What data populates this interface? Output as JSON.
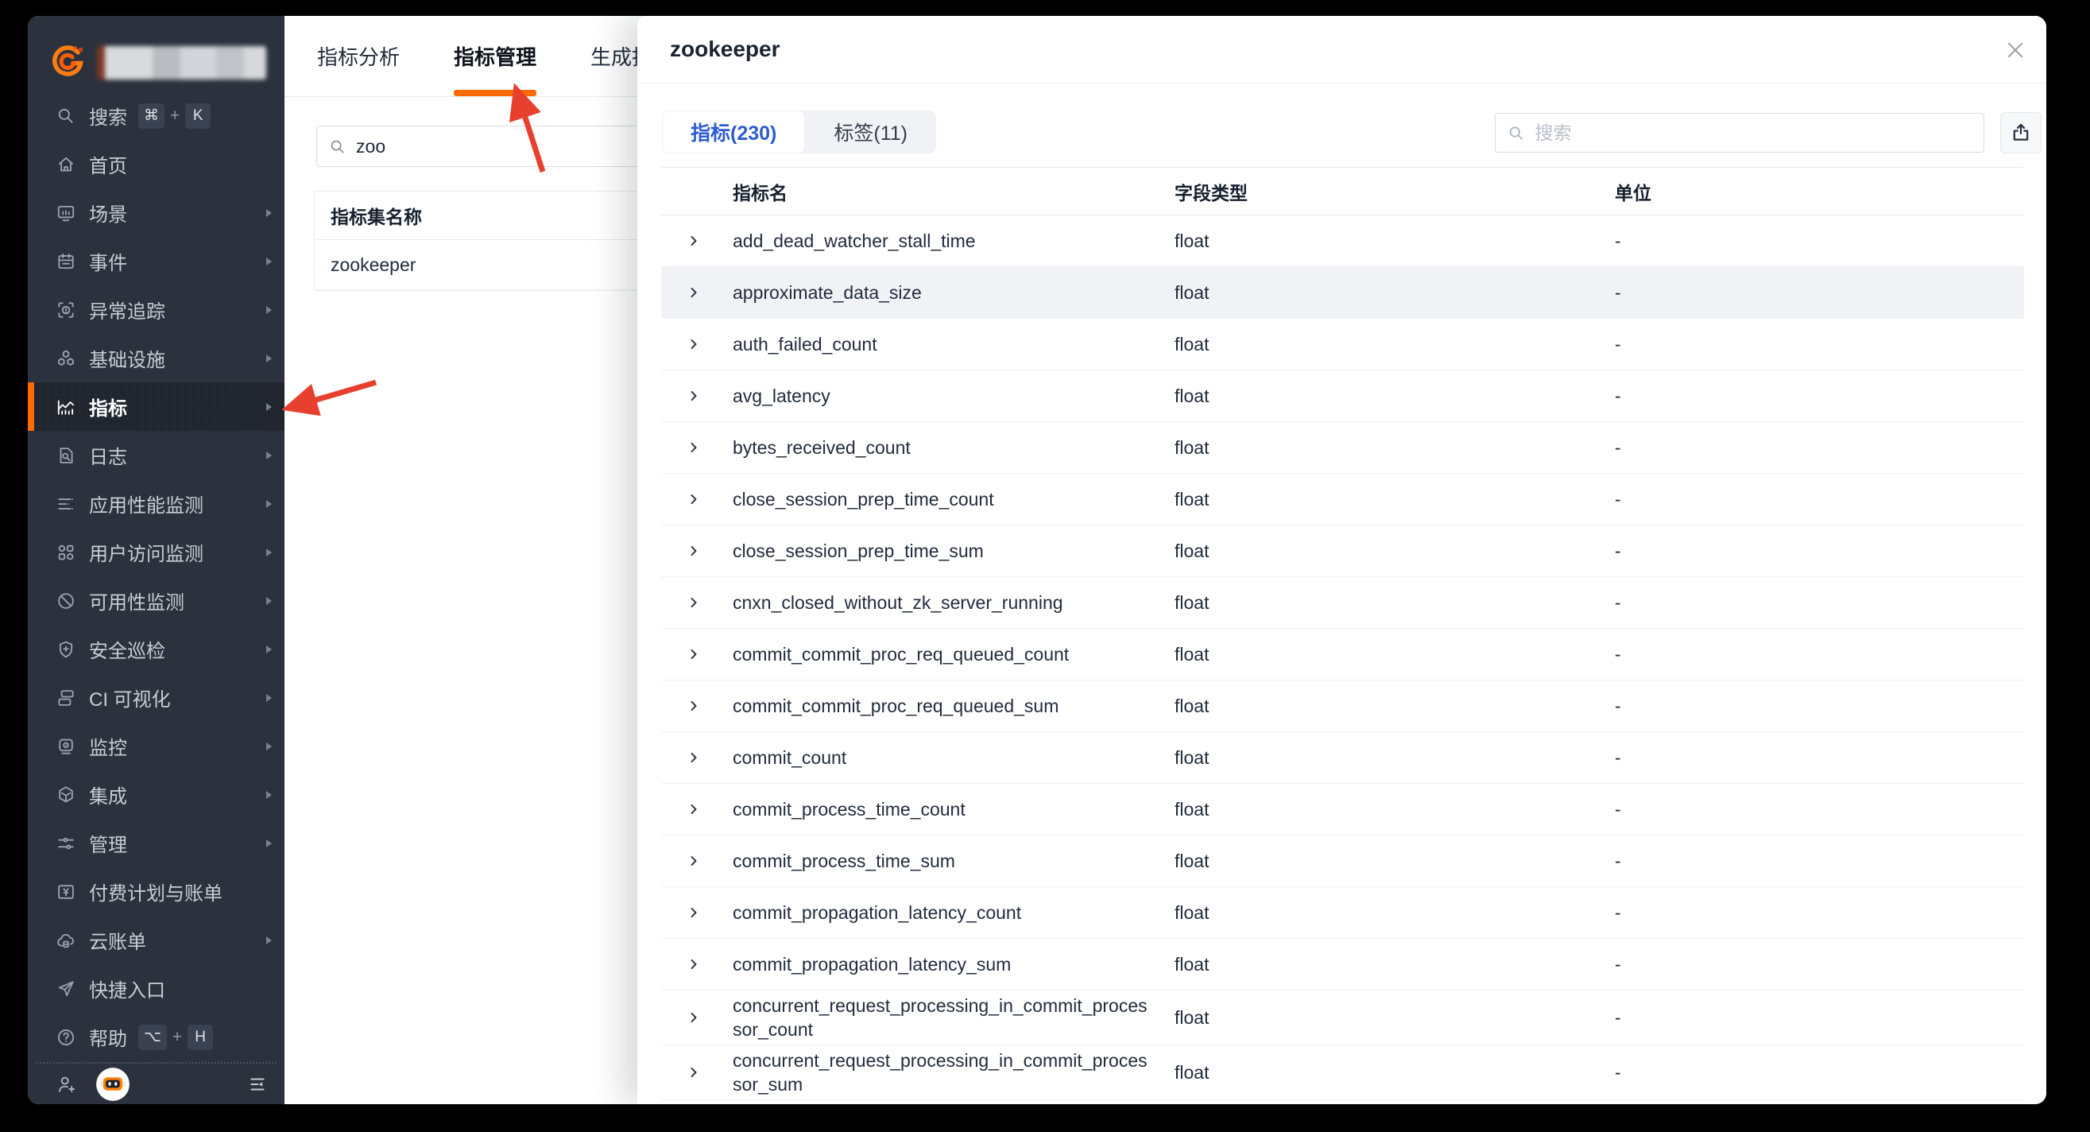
{
  "colors": {
    "accent_orange": "#ff6a00",
    "annotation_red": "#e8402f",
    "active_tab_blue": "#2e5bd0",
    "sidebar_bg": "#2c323d"
  },
  "sidebar": {
    "items": [
      {
        "key": "search",
        "label": "搜索",
        "icon": "search-icon",
        "chevron": false,
        "shortcut_keys": [
          "⌘",
          "K"
        ]
      },
      {
        "key": "home",
        "label": "首页",
        "icon": "home-icon",
        "chevron": false
      },
      {
        "key": "scene",
        "label": "场景",
        "icon": "scene-icon",
        "chevron": true
      },
      {
        "key": "event",
        "label": "事件",
        "icon": "event-icon",
        "chevron": true
      },
      {
        "key": "error-tracking",
        "label": "异常追踪",
        "icon": "error-tracking-icon",
        "chevron": true
      },
      {
        "key": "infrastructure",
        "label": "基础设施",
        "icon": "infrastructure-icon",
        "chevron": true
      },
      {
        "key": "metrics",
        "label": "指标",
        "icon": "metrics-icon",
        "chevron": true,
        "active": true
      },
      {
        "key": "logs",
        "label": "日志",
        "icon": "logs-icon",
        "chevron": true
      },
      {
        "key": "apm",
        "label": "应用性能监测",
        "icon": "apm-icon",
        "chevron": true
      },
      {
        "key": "rum",
        "label": "用户访问监测",
        "icon": "rum-icon",
        "chevron": true
      },
      {
        "key": "availability",
        "label": "可用性监测",
        "icon": "availability-icon",
        "chevron": true
      },
      {
        "key": "security-check",
        "label": "安全巡检",
        "icon": "security-icon",
        "chevron": true
      },
      {
        "key": "ci-visual",
        "label": "CI 可视化",
        "icon": "ci-icon",
        "chevron": true
      },
      {
        "key": "monitor",
        "label": "监控",
        "icon": "monitor-icon",
        "chevron": true
      },
      {
        "key": "integration",
        "label": "集成",
        "icon": "integration-icon",
        "chevron": true
      },
      {
        "key": "manage",
        "label": "管理",
        "icon": "manage-icon",
        "chevron": true
      },
      {
        "key": "billing",
        "label": "付费计划与账单",
        "icon": "billing-icon",
        "chevron": false
      },
      {
        "key": "cloud-bill",
        "label": "云账单",
        "icon": "cloud-bill-icon",
        "chevron": true
      },
      {
        "key": "quick-entry",
        "label": "快捷入口",
        "icon": "quick-entry-icon",
        "chevron": false
      },
      {
        "key": "help",
        "label": "帮助",
        "icon": "help-icon",
        "chevron": false,
        "shortcut_keys": [
          "⌥",
          "H"
        ]
      }
    ]
  },
  "main": {
    "tabs": [
      {
        "key": "metric-analysis",
        "label": "指标分析"
      },
      {
        "key": "metric-manage",
        "label": "指标管理",
        "active": true
      },
      {
        "key": "generate-metric",
        "label": "生成指标"
      }
    ],
    "search_value": "zoo",
    "table": {
      "header": "指标集名称",
      "rows": [
        "zookeeper"
      ]
    }
  },
  "drawer": {
    "title": "zookeeper",
    "tabs": [
      {
        "key": "metrics",
        "label": "指标(230)",
        "active": true
      },
      {
        "key": "labels",
        "label": "标签(11)"
      }
    ],
    "search_placeholder": "搜索",
    "columns": [
      "指标名",
      "字段类型",
      "单位"
    ],
    "rows": [
      {
        "name": "add_dead_watcher_stall_time",
        "type": "float",
        "unit": "-"
      },
      {
        "name": "approximate_data_size",
        "type": "float",
        "unit": "-",
        "highlight": true
      },
      {
        "name": "auth_failed_count",
        "type": "float",
        "unit": "-"
      },
      {
        "name": "avg_latency",
        "type": "float",
        "unit": "-"
      },
      {
        "name": "bytes_received_count",
        "type": "float",
        "unit": "-"
      },
      {
        "name": "close_session_prep_time_count",
        "type": "float",
        "unit": "-"
      },
      {
        "name": "close_session_prep_time_sum",
        "type": "float",
        "unit": "-"
      },
      {
        "name": "cnxn_closed_without_zk_server_running",
        "type": "float",
        "unit": "-"
      },
      {
        "name": "commit_commit_proc_req_queued_count",
        "type": "float",
        "unit": "-"
      },
      {
        "name": "commit_commit_proc_req_queued_sum",
        "type": "float",
        "unit": "-"
      },
      {
        "name": "commit_count",
        "type": "float",
        "unit": "-"
      },
      {
        "name": "commit_process_time_count",
        "type": "float",
        "unit": "-"
      },
      {
        "name": "commit_process_time_sum",
        "type": "float",
        "unit": "-"
      },
      {
        "name": "commit_propagation_latency_count",
        "type": "float",
        "unit": "-"
      },
      {
        "name": "commit_propagation_latency_sum",
        "type": "float",
        "unit": "-"
      },
      {
        "name": "concurrent_request_processing_in_commit_processor_count",
        "type": "float",
        "unit": "-"
      },
      {
        "name": "concurrent_request_processing_in_commit_processor_sum",
        "type": "float",
        "unit": "-"
      }
    ]
  }
}
